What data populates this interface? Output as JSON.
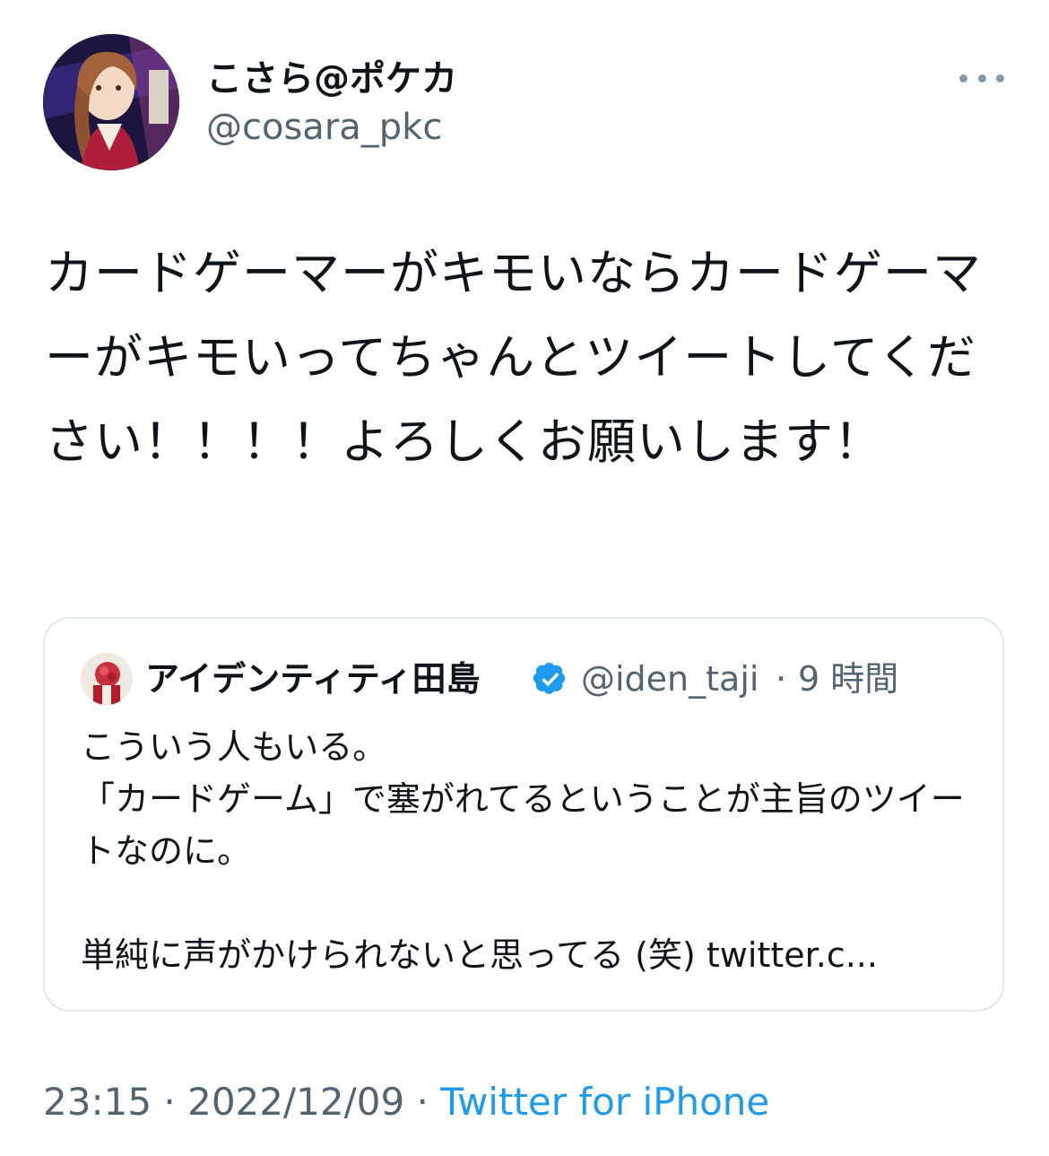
{
  "author": {
    "display_name": "こさら@ポケカ",
    "handle": "@cosara_pkc",
    "avatar_icon": "user-avatar"
  },
  "more_icon": "more-dots-icon",
  "tweet": {
    "text": "カードゲーマーがキモいならカードゲーマーがキモいってちゃんとツイートしてください！！！！よろしくお願いします！"
  },
  "quoted": {
    "display_name": "アイデンティティ田島",
    "verified_icon": "verified-badge-icon",
    "handle": "@iden_taji",
    "separator": "·",
    "time": "9 時間",
    "text": "こういう人もいる。\n「カードゲーム」で塞がれてるということが主旨のツイートなのに。\n\n単純に声がかけられないと思ってる (笑) twitter.c..."
  },
  "footer": {
    "time": "23:15",
    "dot1": " · ",
    "date": "2022/12/09",
    "dot2": " · ",
    "source": "Twitter for iPhone"
  },
  "colors": {
    "text": "#0f1419",
    "secondary": "#536471",
    "link": "#1d9bf0",
    "border": "#e1e8ed"
  }
}
